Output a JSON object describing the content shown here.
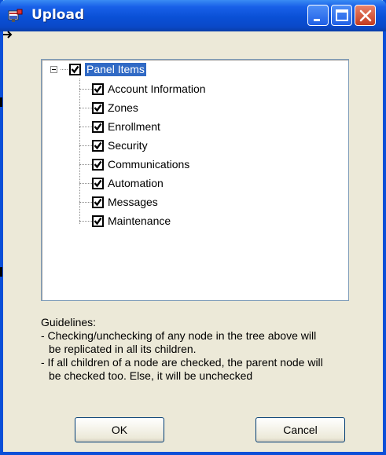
{
  "window": {
    "title": "Upload"
  },
  "tree": {
    "root": {
      "label": "Panel Items",
      "checked": true,
      "expanded": true,
      "selected": true
    },
    "children": [
      {
        "label": "Account Information",
        "checked": true
      },
      {
        "label": "Zones",
        "checked": true
      },
      {
        "label": "Enrollment",
        "checked": true
      },
      {
        "label": "Security",
        "checked": true
      },
      {
        "label": "Communications",
        "checked": true
      },
      {
        "label": "Automation",
        "checked": true
      },
      {
        "label": "Messages",
        "checked": true
      },
      {
        "label": "Maintenance",
        "checked": true
      }
    ]
  },
  "guidelines": {
    "heading": "Guidelines:",
    "line1": "- Checking/unchecking of any node in the tree above will",
    "line2": "be replicated in all its children.",
    "line3": "- If all children of a node are checked, the parent node will",
    "line4": "be checked too. Else, it will be unchecked"
  },
  "buttons": {
    "ok": "OK",
    "cancel": "Cancel"
  },
  "colors": {
    "titlebar": "#0a50d6",
    "dialog_bg": "#ece9d8",
    "selection": "#316ac5"
  }
}
